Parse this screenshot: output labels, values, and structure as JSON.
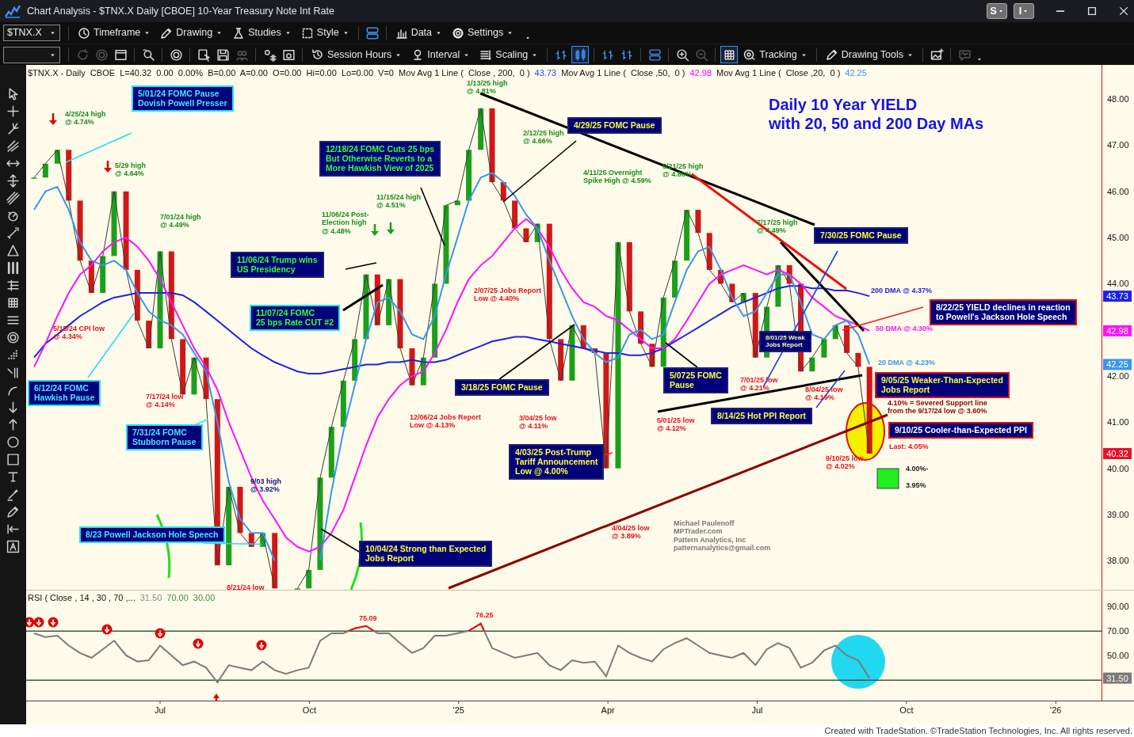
{
  "window": {
    "title": "Chart Analysis - $TNX.X Daily [CBOE] 10-Year Treasury Note Int Rate",
    "buttons": [
      "S",
      "I"
    ]
  },
  "toolbar_1": [
    {
      "kind": "dropdown",
      "label": "$TNX.X"
    },
    {
      "kind": "menu",
      "label": "Timeframe"
    },
    {
      "kind": "menu",
      "label": "Drawing"
    },
    {
      "kind": "menu",
      "label": "Studies"
    },
    {
      "kind": "menu",
      "label": "Style"
    },
    {
      "kind": "icon"
    },
    {
      "kind": "menu",
      "label": "Data"
    },
    {
      "kind": "menu",
      "label": "Settings"
    },
    {
      "kind": "overflow"
    }
  ],
  "toolbar_2": [
    {
      "kind": "dropdown"
    },
    {
      "kind": "icon",
      "disabled": true,
      "selected": false
    },
    {
      "kind": "icon",
      "disabled": true,
      "selected": false
    },
    {
      "kind": "icon",
      "disabled": false,
      "selected": false
    },
    {
      "kind": "icon",
      "disabled": false,
      "selected": false
    },
    {
      "kind": "icon",
      "disabled": false,
      "selected": false
    },
    {
      "kind": "icon",
      "disabled": false,
      "selected": false
    },
    {
      "kind": "icon",
      "disabled": false,
      "selected": false
    },
    {
      "kind": "icon",
      "disabled": true,
      "selected": false
    },
    {
      "kind": "icon",
      "disabled": false,
      "selected": false
    },
    {
      "kind": "icon",
      "disabled": false,
      "selected": false
    },
    {
      "kind": "menu",
      "label": "Session Hours"
    },
    {
      "kind": "menu",
      "label": "Interval"
    },
    {
      "kind": "menu",
      "label": "Scaling"
    },
    {
      "kind": "icon",
      "disabled": false,
      "selected": false
    },
    {
      "kind": "icon",
      "disabled": false,
      "selected": true
    },
    {
      "kind": "icon",
      "disabled": false,
      "selected": false
    },
    {
      "kind": "icon",
      "disabled": false,
      "selected": false
    },
    {
      "kind": "icon",
      "disabled": false,
      "selected": false
    },
    {
      "kind": "icon",
      "disabled": false,
      "selected": false
    },
    {
      "kind": "icon",
      "disabled": true,
      "selected": false
    },
    {
      "kind": "icon",
      "disabled": false,
      "selected": true
    },
    {
      "kind": "menu",
      "label": "Tracking"
    },
    {
      "kind": "menu",
      "label": "Drawing Tools"
    },
    {
      "kind": "icon",
      "disabled": false,
      "selected": false
    },
    {
      "kind": "icon",
      "disabled": true,
      "selected": false
    },
    {
      "kind": "overflow"
    }
  ],
  "legend": [
    {
      "text": "$TNX.X - Daily  CBOE  L=40.32  0.00  0.00%  B=0.00  A=0.00  O=0.00  Hi=0.00  Lo=0.00  V=0  Mov Avg 1 Line (  Close , 200,  0 )"
    },
    {
      "text": "43.73",
      "color": "#1f4fff"
    },
    {
      "text": "Mov Avg 1 Line (  Close ,50,  0 )"
    },
    {
      "text": "42.98",
      "color": "#ff00ff"
    },
    {
      "text": "Mov Avg 1 Line (  Close ,20,  0 )"
    },
    {
      "text": "42.25",
      "color": "#3399ff"
    }
  ],
  "price_chart": {
    "chart_data": {
      "type": "line",
      "x": [
        2024.289,
        2024.308,
        2024.328,
        2024.347,
        2024.366,
        2024.385,
        2024.404,
        2024.423,
        2024.443,
        2024.462,
        2024.481,
        2024.5,
        2024.519,
        2024.538,
        2024.557,
        2024.577,
        2024.596,
        2024.615,
        2024.634,
        2024.653,
        2024.672,
        2024.692,
        2024.711,
        2024.73,
        2024.749,
        2024.768,
        2024.787,
        2024.807,
        2024.826,
        2024.845,
        2024.864,
        2024.883,
        2024.902,
        2024.922,
        2024.941,
        2024.96,
        2024.979,
        2024.998,
        2025.017,
        2025.037,
        2025.056,
        2025.075,
        2025.094,
        2025.113,
        2025.132,
        2025.152,
        2025.171,
        2025.19,
        2025.209,
        2025.228,
        2025.247,
        2025.267,
        2025.286,
        2025.305,
        2025.324,
        2025.343,
        2025.362,
        2025.382,
        2025.401,
        2025.42,
        2025.439,
        2025.458,
        2025.477,
        2025.497,
        2025.516,
        2025.535,
        2025.554,
        2025.573,
        2025.592,
        2025.612,
        2025.631,
        2025.65,
        2025.669,
        2025.688
      ],
      "series": [
        {
          "color": "#3a3a3a",
          "values": [
            46.3,
            46.6,
            46.9,
            45.8,
            44.5,
            43.8,
            44.6,
            46.0,
            44.3,
            43.2,
            42.6,
            44.7,
            42.8,
            41.6,
            42.4,
            41.5,
            37.9,
            39.6,
            38.6,
            38.3,
            38.6,
            37.4,
            null,
            37.4,
            37.8,
            39.8,
            40.9,
            41.9,
            42.8,
            44.2,
            43.1,
            44.1,
            42.6,
            41.8,
            42.4,
            44.0,
            45.7,
            45.8,
            46.9,
            47.8,
            46.2,
            45.8,
            45.2,
            44.9,
            45.3,
            42.8,
            41.9,
            43.1,
            42.6,
            42.5,
            40.0,
            44.9,
            43.4,
            42.7,
            42.2,
            43.7,
            44.5,
            45.6,
            45.1,
            44.3,
            44.0,
            43.6,
            43.8,
            42.4,
            43.5,
            44.4,
            44.0,
            42.1,
            42.4,
            42.8,
            43.1,
            42.5,
            42.2,
            40.32
          ]
        },
        {
          "color": "#1a22e8",
          "values": [
            42.4,
            42.7,
            42.9,
            43.1,
            43.3,
            43.45,
            43.6,
            43.7,
            43.75,
            43.8,
            43.8,
            43.8,
            43.8,
            43.75,
            43.6,
            43.4,
            43.2,
            43.0,
            42.8,
            42.6,
            42.45,
            42.3,
            42.2,
            42.1,
            42.05,
            42.05,
            42.1,
            42.15,
            42.2,
            42.25,
            42.25,
            42.3,
            42.3,
            42.35,
            42.3,
            42.3,
            42.35,
            42.45,
            42.55,
            42.65,
            42.75,
            42.8,
            42.85,
            42.85,
            42.8,
            42.75,
            42.7,
            42.65,
            42.6,
            42.55,
            42.5,
            42.5,
            42.45,
            42.45,
            42.5,
            42.6,
            42.75,
            42.9,
            43.05,
            43.2,
            43.35,
            43.5,
            43.6,
            43.7,
            43.8,
            43.9,
            43.95,
            43.95,
            43.9,
            43.9,
            43.85,
            43.85,
            43.8,
            43.73
          ]
        },
        {
          "color": "#ff10ff",
          "values": [
            42.2,
            42.7,
            43.3,
            43.8,
            44.2,
            44.4,
            44.7,
            44.9,
            45.0,
            44.8,
            44.5,
            44.1,
            43.6,
            43.1,
            42.6,
            42.2,
            41.7,
            41.0,
            40.4,
            39.8,
            39.3,
            38.9,
            38.5,
            38.3,
            38.2,
            38.3,
            38.6,
            39.1,
            39.8,
            40.5,
            41.1,
            41.5,
            41.8,
            42.0,
            42.1,
            42.5,
            43.0,
            43.6,
            44.1,
            44.4,
            44.6,
            44.9,
            45.2,
            45.4,
            45.2,
            44.8,
            44.3,
            43.9,
            43.6,
            43.5,
            43.3,
            43.2,
            43.0,
            42.8,
            42.6,
            42.6,
            42.8,
            43.2,
            43.6,
            44.0,
            44.2,
            44.3,
            44.4,
            44.3,
            44.2,
            44.3,
            44.2,
            44.0,
            43.7,
            43.5,
            43.3,
            43.2,
            43.1,
            42.98
          ]
        },
        {
          "color": "#3a96ea",
          "values": [
            45.6,
            46.0,
            46.1,
            45.6,
            44.9,
            44.5,
            44.4,
            44.5,
            44.3,
            43.8,
            43.4,
            43.2,
            43.1,
            42.9,
            42.5,
            42.1,
            41.0,
            39.7,
            38.9,
            38.6,
            38.6,
            38.0,
            null,
            null,
            null,
            38.0,
            39.5,
            40.8,
            41.8,
            42.8,
            43.6,
            43.7,
            43.4,
            42.9,
            42.8,
            43.3,
            44.2,
            45.0,
            45.8,
            46.3,
            46.4,
            46.2,
            45.9,
            45.5,
            45.2,
            44.5,
            43.9,
            43.3,
            42.8,
            42.5,
            42.3,
            42.4,
            42.9,
            43.0,
            42.8,
            42.9,
            43.6,
            44.3,
            44.7,
            44.8,
            44.3,
            43.7,
            43.3,
            43.4,
            43.8,
            44.2,
            44.2,
            43.6,
            42.9,
            42.8,
            43.1,
            43.2,
            42.9,
            42.25
          ]
        }
      ],
      "xlim": [
        2024.2757,
        2026.131
      ],
      "ylim": [
        37.37,
        48.74
      ],
      "yticks": [
        {
          "value": 48,
          "label": "48.00"
        },
        {
          "value": 47,
          "label": "47.00"
        },
        {
          "value": 46,
          "label": "46.00"
        },
        {
          "value": 45,
          "label": "45.00"
        },
        {
          "value": 44,
          "label": "44.00"
        },
        {
          "value": 42,
          "label": "42.00"
        },
        {
          "value": 41,
          "label": "41.00"
        },
        {
          "value": 40,
          "label": "40.00"
        },
        {
          "value": 39,
          "label": "39.00"
        },
        {
          "value": 38,
          "label": "38.00"
        }
      ]
    },
    "axis_tags": [
      {
        "text": "43.73",
        "color": "#1a22e8"
      },
      {
        "text": "42.98",
        "color": "#ff10ff"
      },
      {
        "text": "42.25",
        "color": "#3a96ea"
      },
      {
        "text": "40.32",
        "color": "#e8102a"
      }
    ],
    "title": {
      "text": "Daily 10 Year YIELD\nwith 20, 50 and 200 Day MAs",
      "color": "#1414e6"
    },
    "drawings": [
      {
        "kind": "highlight",
        "color": "#f5f000"
      },
      {
        "kind": "square",
        "color": "#22ee22"
      },
      {
        "kind": "line",
        "color": "#000000",
        "heavy": true
      },
      {
        "kind": "line",
        "color": "#ee1010",
        "heavy": true
      },
      {
        "kind": "line",
        "color": "#000000",
        "heavy": true
      },
      {
        "kind": "line",
        "color": "#000000",
        "heavy": true
      },
      {
        "kind": "line",
        "color": "#8b0000",
        "heavy": true
      },
      {
        "kind": "line",
        "color": "#000000",
        "heavy": true
      },
      {
        "kind": "line",
        "color": "#22e0f0",
        "heavy": false
      },
      {
        "kind": "line",
        "color": "#22e0f0",
        "heavy": false
      },
      {
        "kind": "line",
        "color": "#22e0f0",
        "heavy": false
      },
      {
        "kind": "line",
        "color": "#22e0f0",
        "heavy": false
      },
      {
        "kind": "line",
        "color": "#000000",
        "heavy": false
      },
      {
        "kind": "line",
        "color": "#000000",
        "heavy": false
      },
      {
        "kind": "line",
        "color": "#000000",
        "heavy": false
      },
      {
        "kind": "line",
        "color": "#000000",
        "heavy": false
      },
      {
        "kind": "line",
        "color": "#000000",
        "heavy": false
      },
      {
        "kind": "line",
        "color": "#000000",
        "heavy": false
      },
      {
        "kind": "line",
        "color": "#2040e0",
        "heavy": false
      },
      {
        "kind": "line",
        "color": "#2040e0",
        "heavy": false
      },
      {
        "kind": "line",
        "color": "#ee2020",
        "heavy": false
      },
      {
        "kind": "line",
        "color": "#ee2020",
        "heavy": false
      },
      {
        "kind": "down-arrow",
        "color": "#e00000"
      },
      {
        "kind": "down-arrow",
        "color": "#e00000"
      },
      {
        "kind": "down-arrow",
        "color": "#14a014"
      },
      {
        "kind": "down-arrow",
        "color": "#14a014"
      },
      {
        "kind": "arc",
        "color": "#22dd22"
      },
      {
        "kind": "arc",
        "color": "#22dd22"
      }
    ],
    "labels": [
      {
        "text": "1/13/25 high\n@ 4.81%",
        "color": "#1a8c1a"
      },
      {
        "text": "4/25/24 high\n@ 4.74%",
        "color": "#1a8c1a"
      },
      {
        "text": "2/12/25 high\n@ 4.66%",
        "color": "#1a8c1a"
      },
      {
        "text": "5/29 high\n@ 4.64%",
        "color": "#1a8c1a"
      },
      {
        "text": "4/11/25 Overnight\nSpike High @ 4.59%",
        "color": "#1a8c1a"
      },
      {
        "text": "5/21/25 high\n@ 4.60%",
        "color": "#1a8c1a"
      },
      {
        "text": "11/15/24 high\n@ 4.51%",
        "color": "#1a8c1a"
      },
      {
        "text": "7/01/24 high\n@ 4.49%",
        "color": "#1a8c1a"
      },
      {
        "text": "11/06/24 Post-\nElection high\n@ 4.48%",
        "color": "#1a8c1a"
      },
      {
        "text": "7/17/25 high\n@ 4.49%",
        "color": "#1a8c1a"
      },
      {
        "text": "2/07/25 Jobs Report\nLow @ 4.40%",
        "color": "#e8101e"
      },
      {
        "text": "200 DMA @ 4.37%",
        "color": "#1a22e8"
      },
      {
        "text": "5/15/24 CPI low\n@ 4.34%",
        "color": "#e8101e"
      },
      {
        "text": "50 DMA @ 4.30%",
        "color": "#ff10ff"
      },
      {
        "text": "20 DMA @ 4.23%",
        "color": "#3a96ea"
      },
      {
        "text": "7/17/24 low\n@ 4.14%",
        "color": "#e8101e"
      },
      {
        "text": "7/01/25 low\n@ 4.21%",
        "color": "#e8101e"
      },
      {
        "text": "8/04/25 low\n@ 4.19%",
        "color": "#e8101e"
      },
      {
        "text": "4.10% = Severed Support line\nfrom the 9/17/24 low @ 3.60%",
        "color": "#8b0000"
      },
      {
        "text": "12/06/24 Jobs Report\nLow @ 4.13%",
        "color": "#e8101e"
      },
      {
        "text": "3/04/25 low\n@ 4.11%",
        "color": "#e8101e"
      },
      {
        "text": "5/01/25 low\n@ 4.12%",
        "color": "#e8101e"
      },
      {
        "text": "Last: 4.05%",
        "color": "#e8101e"
      },
      {
        "text": "9/10/25 low\n@ 4.02%",
        "color": "#e8101e"
      },
      {
        "text": "4.00%-",
        "color": "#202020"
      },
      {
        "text": "9/03 high\n@ 3.92%",
        "color": "#101080"
      },
      {
        "text": "3.95%",
        "color": "#202020"
      },
      {
        "text": "4/04/25 low\n@ 3.89%",
        "color": "#e8101e"
      },
      {
        "text": "Michael Paulenoff\nMPTrader.com\nPattern Analytics, Inc\npatternanalytics@gmail.com",
        "color": "#787878"
      },
      {
        "text": "8/21/24 low",
        "color": "#e8101e"
      }
    ],
    "boxes": [
      {
        "kind": "framed",
        "text": "5/01/24 FOMC Pause\nDovish Powell Presser",
        "color": "#4de1ff"
      },
      {
        "kind": "plain",
        "text": "4/29/25 FOMC Pause",
        "color": "#ffff33"
      },
      {
        "kind": "plain",
        "text": "12/18/24 FOMC Cuts 25 bps\nBut Otherwise Reverts to a\nMore Hawkish View of 2025",
        "color": "#33ff33"
      },
      {
        "kind": "plain",
        "text": "7/30/25 FOMC Pause",
        "color": "#ffff33"
      },
      {
        "kind": "plain",
        "text": "11/06/24 Trump wins\nUS Presidency",
        "color": "#33ff33"
      },
      {
        "kind": "framed",
        "text": "11/07/24 FOMC\n25 bps Rate CUT #2",
        "color": "#33ff33"
      },
      {
        "kind": "plain",
        "text": "8/01/25 Weak\nJobs Report",
        "color": "#ffff99"
      },
      {
        "kind": "alert",
        "text": "8/22/25 YIELD declines in reaction\nto Powell's Jackson Hole Speech",
        "color": "#ffffff"
      },
      {
        "kind": "framed",
        "text": "6/12/24 FOMC\nHawkish Pause",
        "color": "#4de1ff"
      },
      {
        "kind": "plain",
        "text": "3/18/25 FOMC Pause",
        "color": "#ffff33"
      },
      {
        "kind": "plain",
        "text": "5/0725 FOMC\nPause",
        "color": "#ffff33"
      },
      {
        "kind": "alert",
        "text": "9/05/25 Weaker-Than-Expected\nJobs Report",
        "color": "#ffff33"
      },
      {
        "kind": "framed",
        "text": "7/31/24 FOMC\nStubborn Pause",
        "color": "#4de1ff"
      },
      {
        "kind": "plain",
        "text": "4/03/25 Post-Trump\nTariff Announcement\nLow @ 4.00%",
        "color": "#ffff33"
      },
      {
        "kind": "plain",
        "text": "8/14/25 Hot PPI Report",
        "color": "#ffff33"
      },
      {
        "kind": "alert",
        "text": "9/10/25 Cooler-than-Expected PPI",
        "color": "#ffffff"
      },
      {
        "kind": "framed",
        "text": "8/23 Powell Jackson Hole Speech",
        "color": "#4de1ff"
      },
      {
        "kind": "plain",
        "text": "10/04/24 Strong than Expected\nJobs Report",
        "color": "#ffff33"
      }
    ]
  },
  "rsi_legend": [
    {
      "text": "RSI ( Close , 14 , 30 , 70 ,..."
    },
    {
      "text": "31.50",
      "color": "#8a8a8a"
    },
    {
      "text": "70.00",
      "color": "#3f8f3f"
    },
    {
      "text": "30.00",
      "color": "#3f8f3f"
    }
  ],
  "rsi_chart": {
    "chart_data": {
      "type": "line",
      "x": [
        2024.289,
        2024.308,
        2024.328,
        2024.347,
        2024.366,
        2024.385,
        2024.404,
        2024.423,
        2024.443,
        2024.462,
        2024.481,
        2024.5,
        2024.519,
        2024.538,
        2024.557,
        2024.577,
        2024.596,
        2024.615,
        2024.634,
        2024.653,
        2024.672,
        2024.692,
        2024.711,
        2024.73,
        2024.749,
        2024.768,
        2024.787,
        2024.807,
        2024.826,
        2024.845,
        2024.864,
        2024.883,
        2024.902,
        2024.922,
        2024.941,
        2024.96,
        2024.979,
        2024.998,
        2025.017,
        2025.037,
        2025.056,
        2025.075,
        2025.094,
        2025.113,
        2025.132,
        2025.152,
        2025.171,
        2025.19,
        2025.209,
        2025.228,
        2025.247,
        2025.267,
        2025.286,
        2025.305,
        2025.324,
        2025.343,
        2025.362,
        2025.382,
        2025.401,
        2025.42,
        2025.439,
        2025.458,
        2025.477,
        2025.497,
        2025.516,
        2025.535,
        2025.554,
        2025.573,
        2025.592,
        2025.612,
        2025.631,
        2025.65,
        2025.669,
        2025.688
      ],
      "series": [
        {
          "color": "#7a7a7a",
          "values": [
            68,
            65,
            66,
            58,
            52,
            48,
            55,
            62,
            50,
            45,
            46,
            58,
            50,
            42,
            45,
            40,
            28,
            42,
            40,
            38,
            45,
            38,
            35,
            38,
            40,
            62,
            68,
            68,
            72,
            74,
            68,
            68,
            60,
            52,
            56,
            66,
            66,
            68,
            70,
            76,
            56,
            52,
            48,
            50,
            52,
            42,
            38,
            46,
            44,
            45,
            33,
            58,
            52,
            48,
            45,
            55,
            60,
            64,
            58,
            52,
            50,
            48,
            52,
            42,
            55,
            60,
            56,
            40,
            44,
            54,
            58,
            50,
            46,
            31.5
          ]
        }
      ],
      "xlim": [
        2024.2757,
        2026.131
      ],
      "ylim": [
        13.2,
        103.5
      ],
      "yticks": [
        {
          "value": 90,
          "label": "90.00"
        },
        {
          "value": 70,
          "label": "70.00"
        },
        {
          "value": 50,
          "label": "50.00"
        }
      ],
      "xticks": [
        {
          "value": 2024.5,
          "label": "Jul"
        },
        {
          "value": 2024.75,
          "label": "Oct"
        },
        {
          "value": 2025,
          "label": "'25"
        },
        {
          "value": 2025.25,
          "label": "Apr"
        },
        {
          "value": 2025.5,
          "label": "Jul"
        },
        {
          "value": 2025.75,
          "label": "Oct"
        },
        {
          "value": 2026,
          "label": "'26"
        }
      ]
    },
    "axis_tags": [
      {
        "text": "31.50",
        "color": "#7a7a7a"
      }
    ],
    "drawings": [
      {
        "kind": "spot",
        "color": "#22d8f0"
      },
      {
        "kind": "level-line",
        "color": "#3a5a3a"
      },
      {
        "kind": "level-line",
        "color": "#3a5a3a"
      },
      {
        "kind": "alert",
        "color": "#e00000"
      },
      {
        "kind": "alert",
        "color": "#e00000"
      },
      {
        "kind": "alert",
        "color": "#e00000"
      },
      {
        "kind": "alert",
        "color": "#e00000"
      },
      {
        "kind": "alert",
        "color": "#e00000"
      },
      {
        "kind": "alert",
        "color": "#e00000"
      },
      {
        "kind": "alert",
        "color": "#e00000"
      },
      {
        "kind": "up-arrow",
        "color": "#e00000"
      }
    ],
    "labels": [
      {
        "text": "75.09",
        "color": "#e8101e"
      },
      {
        "text": "76.25",
        "color": "#e8101e"
      }
    ]
  },
  "footer": "Created with TradeStation. ©TradeStation Technologies, Inc. All rights reserved."
}
